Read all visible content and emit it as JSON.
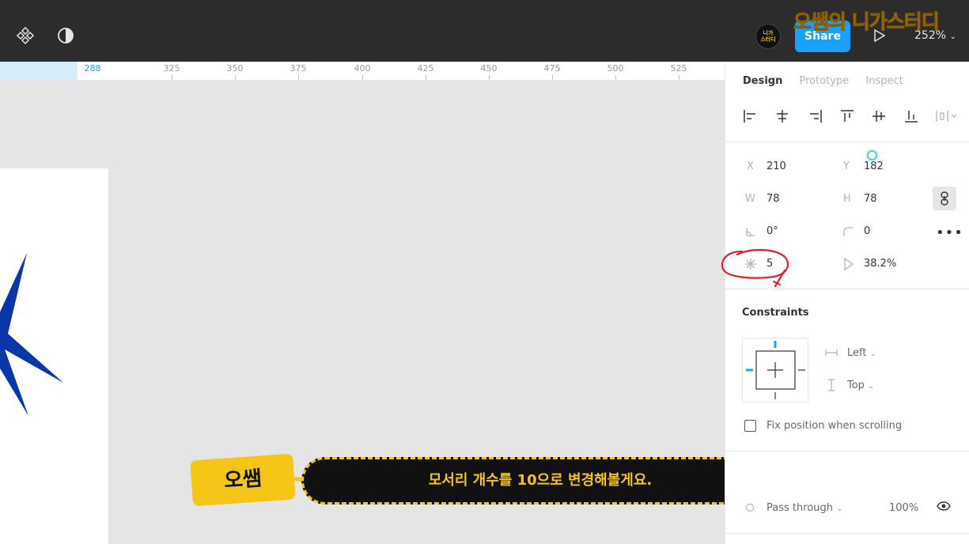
{
  "toolbar": {
    "zoom": "252%",
    "share_label": "Share",
    "avatar_text": "니가\n스터디",
    "channel_logo": "오쌤의 니가스터디"
  },
  "ruler": {
    "labels": [
      "288",
      "325",
      "350",
      "375",
      "400",
      "425",
      "450",
      "475",
      "500",
      "525"
    ],
    "highlighted": "288"
  },
  "caption": {
    "speaker": "오쌤",
    "text": "모서리 개수를 10으로 변경해볼게요."
  },
  "panel": {
    "tabs": [
      "Design",
      "Prototype",
      "Inspect"
    ],
    "active_tab": "Design",
    "x_label": "X",
    "x_value": "210",
    "y_label": "Y",
    "y_value": "182",
    "w_label": "W",
    "w_value": "78",
    "h_label": "H",
    "h_value": "78",
    "rotation_value": "0°",
    "radius_value": "0",
    "point_count": "5",
    "ratio_value": "38.2%",
    "constraints_title": "Constraints",
    "horizontal_constraint": "Left",
    "vertical_constraint": "Top",
    "fix_position_label": "Fix position when scrolling",
    "blend_mode": "Pass through",
    "opacity": "100%"
  },
  "colors": {
    "accent": "#18a0fb",
    "star": "#0b36a8",
    "annotation": "#e0202a",
    "caption_yellow": "#f5c518"
  }
}
